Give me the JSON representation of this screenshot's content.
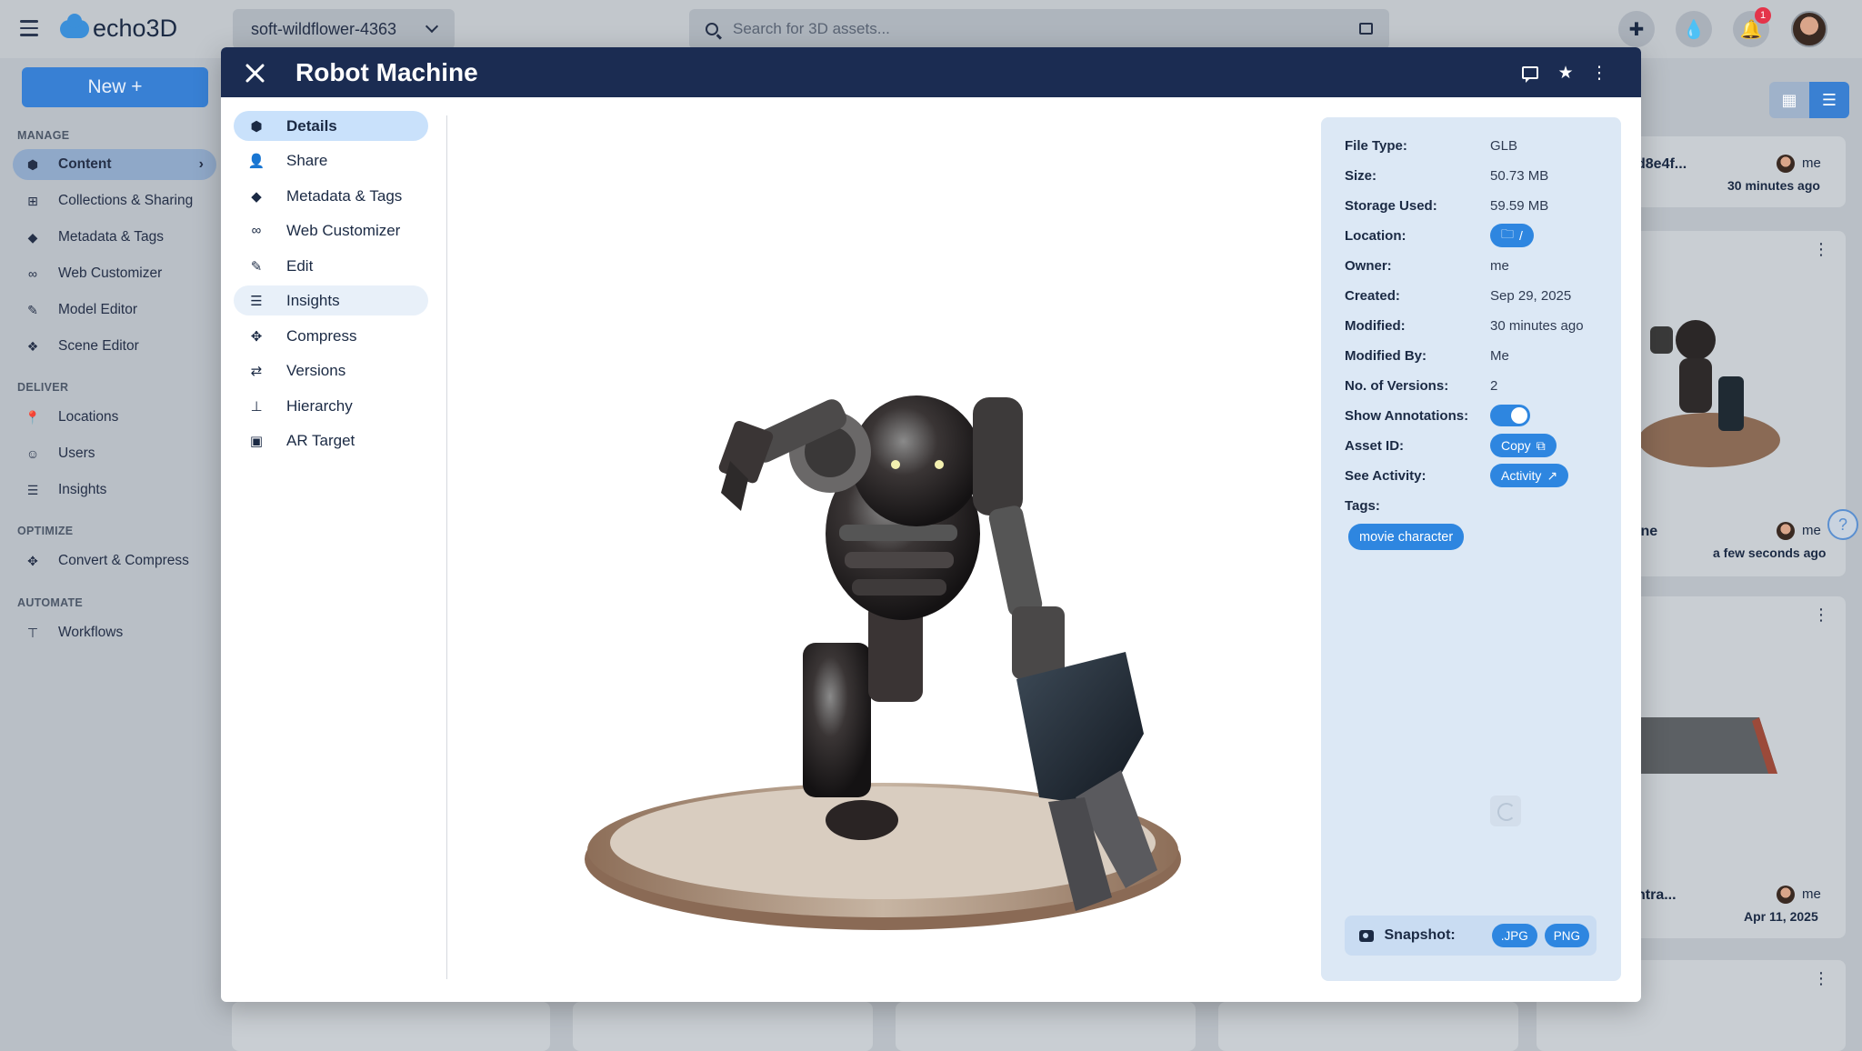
{
  "app": {
    "name": "echo3D",
    "project": "soft-wildflower-4363",
    "search_placeholder": "Search for 3D assets...",
    "notifications_count": "1"
  },
  "sidebar": {
    "new_button": "New +",
    "sections": [
      {
        "title": "MANAGE",
        "items": [
          "Content",
          "Collections & Sharing",
          "Metadata & Tags",
          "Web Customizer",
          "Model Editor",
          "Scene Editor"
        ]
      },
      {
        "title": "DELIVER",
        "items": [
          "Locations",
          "Users",
          "Insights"
        ]
      },
      {
        "title": "OPTIMIZE",
        "items": [
          "Convert & Compress"
        ]
      },
      {
        "title": "AUTOMATE",
        "items": [
          "Workflows"
        ]
      }
    ],
    "active_item": "Content"
  },
  "background_cards": [
    {
      "name_fragment": "d8e4f...",
      "owner": "me",
      "time": "30 minutes ago"
    },
    {
      "name_fragment": "ine",
      "owner": "me",
      "time": "a few seconds ago"
    },
    {
      "name_fragment": "ntra...",
      "owner": "me",
      "time": "Apr 11, 2025"
    }
  ],
  "modal": {
    "title": "Robot Machine",
    "nav": [
      "Details",
      "Share",
      "Metadata & Tags",
      "Web Customizer",
      "Edit",
      "Insights",
      "Compress",
      "Versions",
      "Hierarchy",
      "AR Target"
    ],
    "active_nav": "Details",
    "details": {
      "file_type_label": "File Type:",
      "file_type": "GLB",
      "size_label": "Size:",
      "size": "50.73 MB",
      "storage_label": "Storage Used:",
      "storage": "59.59 MB",
      "location_label": "Location:",
      "location": "/",
      "owner_label": "Owner:",
      "owner": "me",
      "created_label": "Created:",
      "created": "Sep 29, 2025",
      "modified_label": "Modified:",
      "modified": "30 minutes ago",
      "modified_by_label": "Modified By:",
      "modified_by": "Me",
      "versions_label": "No. of Versions:",
      "versions": "2",
      "annotations_label": "Show Annotations:",
      "annotations_on": true,
      "asset_id_label": "Asset ID:",
      "asset_id_button": "Copy",
      "activity_label": "See Activity:",
      "activity_button": "Activity",
      "tags_label": "Tags:",
      "tags": [
        "movie character"
      ],
      "snapshot_label": "Snapshot:",
      "snapshot_formats": [
        ".JPG",
        "PNG"
      ]
    }
  },
  "colors": {
    "header": "#1b2c52",
    "accent": "#2e86e0",
    "panel": "#dce8f5"
  }
}
